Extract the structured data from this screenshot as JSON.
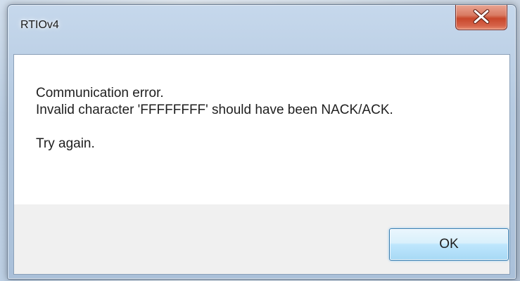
{
  "window": {
    "title": "RTIOv4"
  },
  "message": {
    "line1": "Communication error.",
    "line2": "Invalid character 'FFFFFFFF' should have been NACK/ACK.",
    "line3": "Try again."
  },
  "buttons": {
    "ok_label": "OK",
    "close_icon": "close-x-icon"
  },
  "colors": {
    "close_button": "#c8472b",
    "ok_button_border": "#3c7fb1",
    "button_area": "#f0f0f0"
  }
}
